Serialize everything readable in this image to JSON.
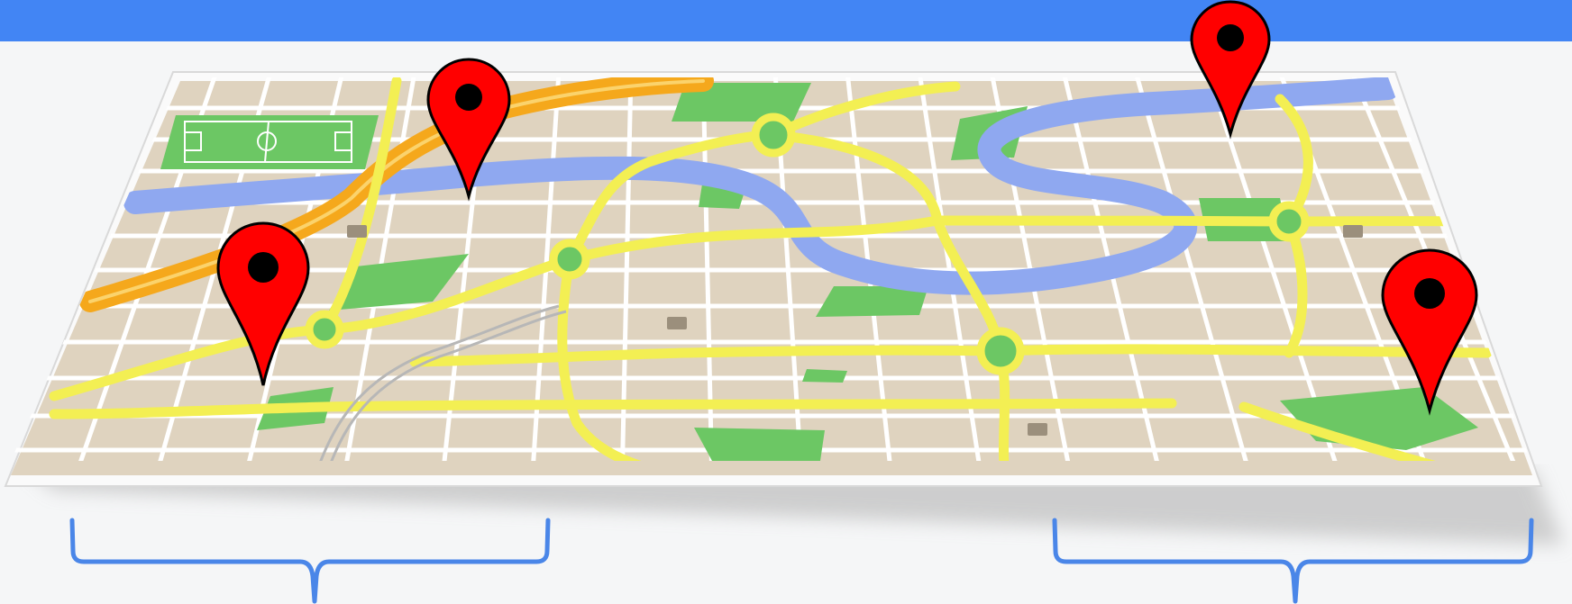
{
  "header": {
    "title_fragment": "",
    "background_color": "#4285f4"
  },
  "map": {
    "land_color": "#dfd3bf",
    "block_color": "#d8cbb4",
    "street_color": "#ffffff",
    "road_color": "#f3ef53",
    "highway_color": "#f5a81c",
    "water_color": "#8fa8f0",
    "park_color": "#6cc764"
  },
  "pins": [
    {
      "name": "map-pin-left",
      "color": "#ff0000"
    },
    {
      "name": "map-pin-upper-left",
      "color": "#ff0000"
    },
    {
      "name": "map-pin-upper-right",
      "color": "#ff0000"
    },
    {
      "name": "map-pin-right",
      "color": "#ff0000"
    }
  ],
  "brackets": {
    "color": "#4a86e8"
  }
}
